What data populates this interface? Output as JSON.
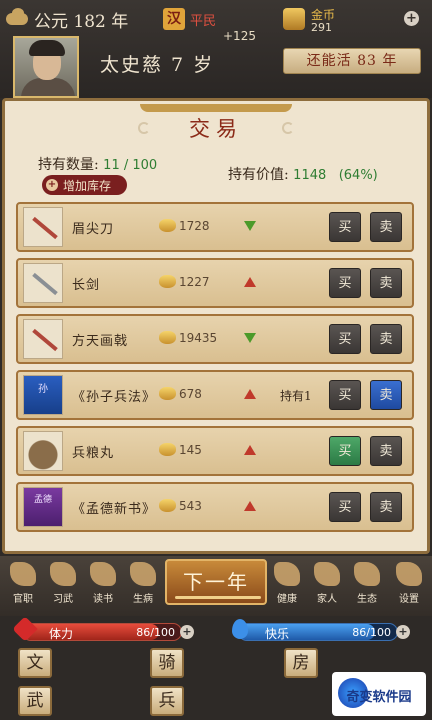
{
  "header": {
    "year_text": "公元 182 年",
    "nation": "汉",
    "status": "平民",
    "delta": "+125",
    "gold_label": "金币",
    "gold_value": "291",
    "hero_name": "太史慈 7 岁",
    "life_left": "还能活 83 年"
  },
  "panel": {
    "title": "交易",
    "hold_label": "持有数量:",
    "hold_value": "11 / 100",
    "add_stock": "增加库存",
    "value_label": "持有价值:",
    "value_amount": "1148",
    "value_percent": "(64%)"
  },
  "items": [
    {
      "name": "眉尖刀",
      "price": "1728",
      "trend": "down",
      "held": "",
      "buy": "买",
      "sell": "卖"
    },
    {
      "name": "长剑",
      "price": "1227",
      "trend": "up",
      "held": "",
      "buy": "买",
      "sell": "卖"
    },
    {
      "name": "方天画戟",
      "price": "19435",
      "trend": "down",
      "held": "",
      "buy": "买",
      "sell": "卖"
    },
    {
      "name": "《孙子兵法》",
      "price": "678",
      "trend": "up",
      "held": "持有1",
      "buy": "买",
      "sell": "卖",
      "thumb_text": "孙"
    },
    {
      "name": "兵粮丸",
      "price": "145",
      "trend": "up",
      "held": "",
      "buy": "买",
      "sell": "卖"
    },
    {
      "name": "《孟德新书》",
      "price": "543",
      "trend": "up",
      "held": "",
      "buy": "买",
      "sell": "卖",
      "thumb_text": "孟德"
    }
  ],
  "nav": {
    "left": [
      "官职",
      "习武",
      "读书",
      "生病"
    ],
    "next_year": "下一年",
    "right": [
      "健康",
      "家人",
      "生态",
      "设置"
    ]
  },
  "stats": {
    "hp_label": "体力",
    "hp_value": "86/100",
    "hp_fraction": 0.86,
    "joy_label": "快乐",
    "joy_value": "86/100",
    "joy_fraction": 0.86
  },
  "tiles": {
    "wen": "文",
    "qi": "骑",
    "fang": "房",
    "wu": "武",
    "bing": "兵"
  },
  "watermark": "奇变软件园",
  "colors": {
    "accent_red": "#8b2a18",
    "up": "#c0392b",
    "down": "#4c9a2a",
    "value_green": "#2e7d32"
  }
}
